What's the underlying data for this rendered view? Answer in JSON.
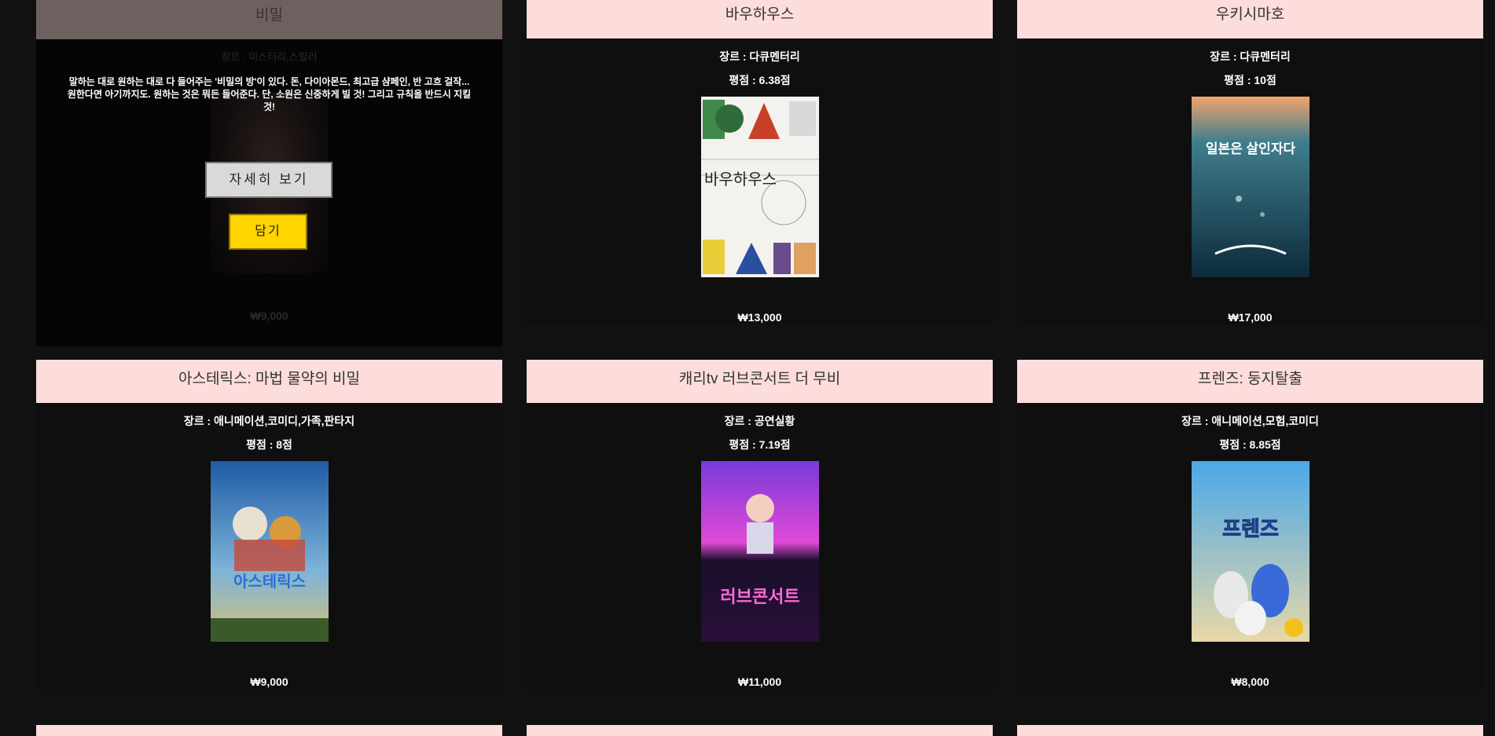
{
  "overlay": {
    "title": "비밀",
    "genre": "장르 : 미스터리,스릴러",
    "overview": "말하는 대로 원하는 대로 다 들어주는 '비밀의 방'이 있다.  돈, 다이아몬드, 최고급 샴페인, 반 고흐 걸작...  원한다면 아기까지도.    원하는 것은 뭐든 들어준다.  단, 소원은 신중하게 빌 것!  그리고 규칙을 반드시 지킬 것!",
    "detail_button": "자세히 보기",
    "cart_button": "담기",
    "price": "₩9,000"
  },
  "movies": [
    {
      "title": "바우하우스",
      "genre": "장르 : 다큐멘터리",
      "score": "평점 : 6.38점",
      "price": "₩13,000",
      "poster_text": "바우하우스"
    },
    {
      "title": "우키시마호",
      "genre": "장르 : 다큐멘터리",
      "score": "평점 : 10점",
      "price": "₩17,000",
      "poster_text": "일본은 살인자다"
    },
    {
      "title": "아스테릭스: 마법 물약의 비밀",
      "genre": "장르 : 애니메이션,코미디,가족,판타지",
      "score": "평점 : 8점",
      "price": "₩9,000",
      "poster_text": "아스테릭스"
    },
    {
      "title": "캐리tv 러브콘서트 더 무비",
      "genre": "장르 : 공연실황",
      "score": "평점 : 7.19점",
      "price": "₩11,000",
      "poster_text": "러브콘서트"
    },
    {
      "title": "프렌즈: 둥지탈출",
      "genre": "장르 : 애니메이션,모험,코미디",
      "score": "평점 : 8.85점",
      "price": "₩8,000",
      "poster_text": "프렌즈"
    }
  ]
}
